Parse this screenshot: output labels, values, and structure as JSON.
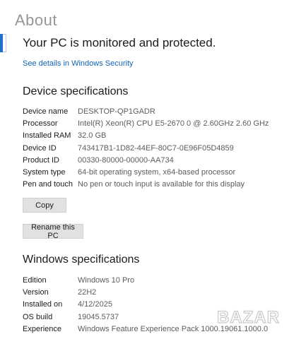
{
  "page": {
    "ghost_title": "About",
    "headline": "Your PC is monitored and protected.",
    "security_link": "See details in Windows Security"
  },
  "device_specs": {
    "title": "Device specifications",
    "rows": [
      {
        "label": "Device name",
        "value": "DESKTOP-QP1GADR"
      },
      {
        "label": "Processor",
        "value": "Intel(R) Xeon(R) CPU E5-2670 0 @ 2.60GHz   2.60 GHz"
      },
      {
        "label": "Installed RAM",
        "value": "32.0 GB"
      },
      {
        "label": "Device ID",
        "value": "743417B1-1D82-44EF-80C7-0E96F05D4859"
      },
      {
        "label": "Product ID",
        "value": "00330-80000-00000-AA734"
      },
      {
        "label": "System type",
        "value": "64-bit operating system, x64-based processor"
      },
      {
        "label": "Pen and touch",
        "value": "No pen or touch input is available for this display"
      }
    ],
    "copy_label": "Copy",
    "rename_label": "Rename this PC"
  },
  "windows_specs": {
    "title": "Windows specifications",
    "rows": [
      {
        "label": "Edition",
        "value": "Windows 10 Pro"
      },
      {
        "label": "Version",
        "value": "22H2"
      },
      {
        "label": "Installed on",
        "value": "4/12/2025"
      },
      {
        "label": "OS build",
        "value": "19045.5737"
      },
      {
        "label": "Experience",
        "value": "Windows Feature Experience Pack 1000.19061.1000.0"
      }
    ]
  },
  "watermark": {
    "text": "BAZAR"
  },
  "colors": {
    "accent": "#1064b7",
    "button_bg": "#e1e1e1",
    "value_text": "#5c5c5c"
  }
}
